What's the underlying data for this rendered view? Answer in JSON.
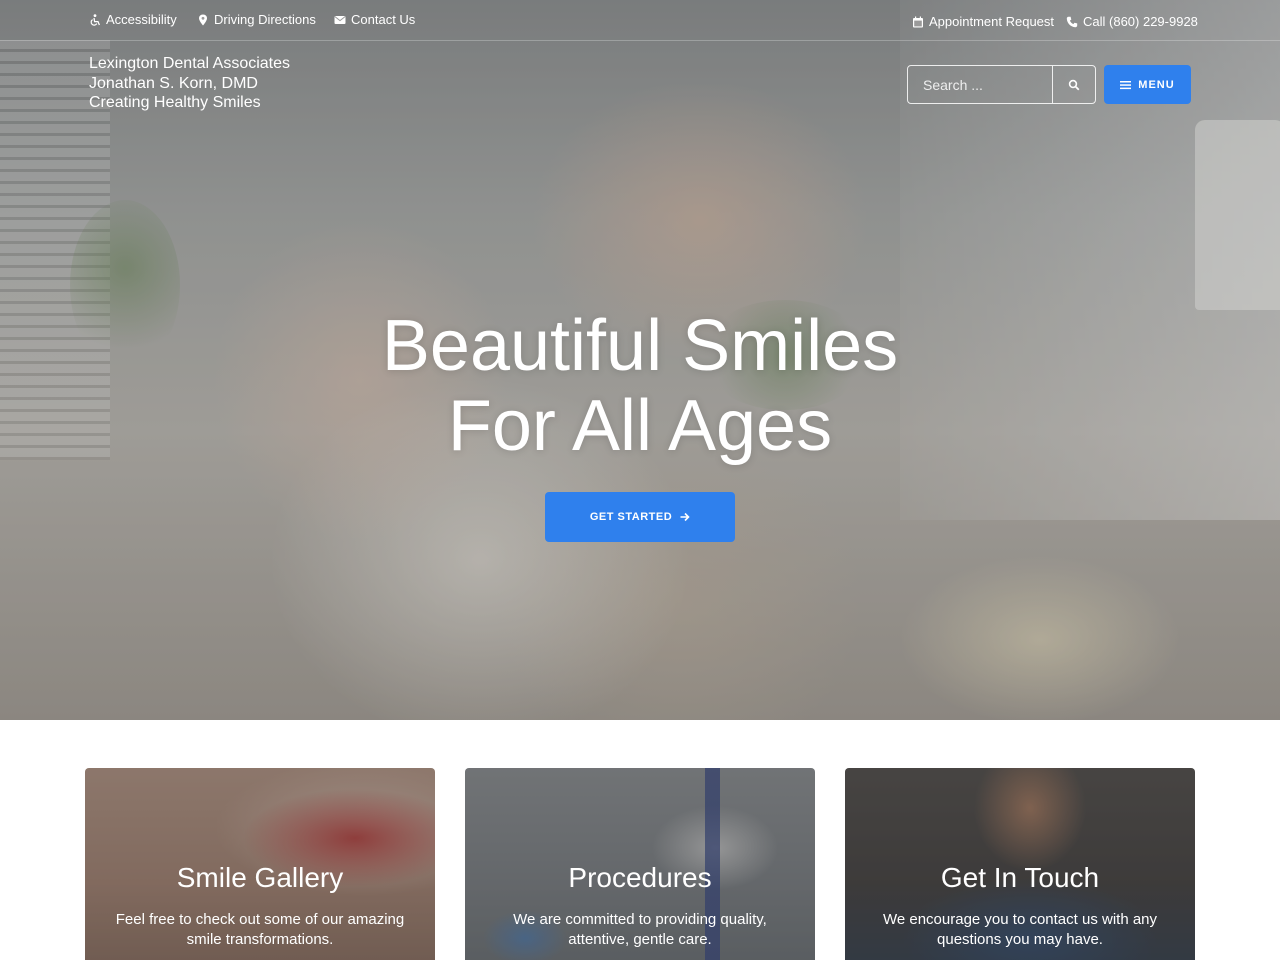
{
  "colors": {
    "accent": "#2f80ed",
    "text_light": "#ffffff"
  },
  "topbar": {
    "accessibility": {
      "label": "Accessibility",
      "icon": "wheelchair-icon"
    },
    "directions": {
      "label": "Driving Directions",
      "icon": "map-marker-icon"
    },
    "contact": {
      "label": "Contact Us",
      "icon": "envelope-icon"
    },
    "appointment": {
      "label": "Appointment Request",
      "icon": "calendar-icon"
    },
    "phone": {
      "label": "Call (860) 229-9928",
      "icon": "phone-icon"
    }
  },
  "brand": {
    "line1": "Lexington Dental Associates",
    "line2": "Jonathan S. Korn, DMD",
    "line3": "Creating Healthy Smiles"
  },
  "search": {
    "placeholder": "Search ...",
    "icon": "search-icon"
  },
  "menu": {
    "label": "MENU",
    "icon": "hamburger-icon"
  },
  "hero": {
    "headline_line1": "Beautiful Smiles",
    "headline_line2": "For All Ages",
    "cta_label": "GET STARTED",
    "cta_icon": "arrow-right-icon"
  },
  "cards": [
    {
      "title": "Smile Gallery",
      "text": "Feel free to check out some of our amazing smile transformations."
    },
    {
      "title": "Procedures",
      "text": "We are committed to providing quality, attentive, gentle care."
    },
    {
      "title": "Get In Touch",
      "text": "We encourage you to contact us with any questions you may have."
    }
  ]
}
